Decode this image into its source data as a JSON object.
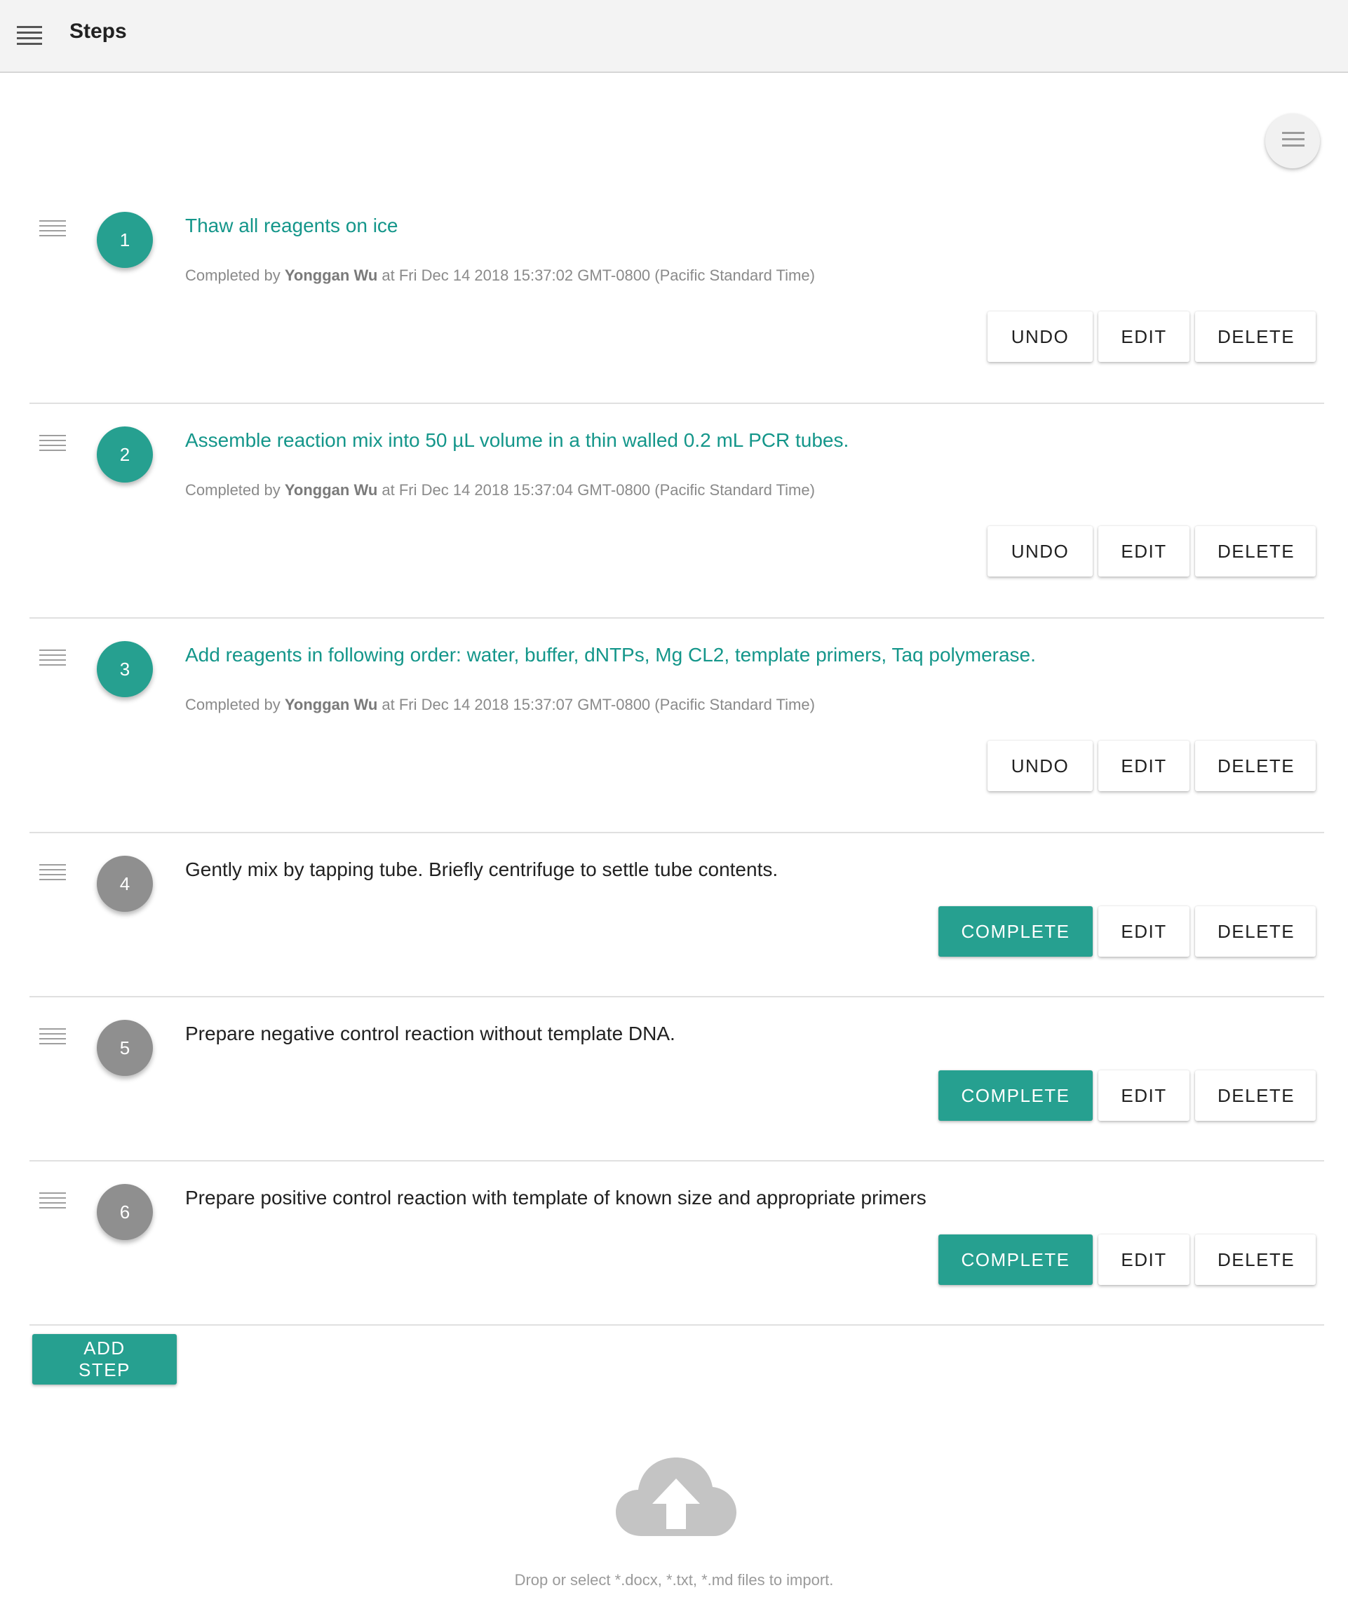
{
  "header": {
    "title": "Steps",
    "menu_icon": "hamburger-menu-icon"
  },
  "options_button": {
    "icon": "list-icon"
  },
  "colors": {
    "accent": "#26a090",
    "completed_text": "#14968a",
    "pending_circle": "#8f8f8f",
    "topbar": "#f3f3f3"
  },
  "steps": [
    {
      "number": "1",
      "status": "completed",
      "text": "Thaw all reagents on ice",
      "completed_prefix": "Completed by",
      "completed_by": "Yonggan Wu",
      "completed_at": "at Fri Dec 14 2018 15:37:02 GMT-0800 (Pacific Standard Time)",
      "primary_label": "UNDO",
      "edit_label": "EDIT",
      "delete_label": "DELETE"
    },
    {
      "number": "2",
      "status": "completed",
      "text": "Assemble reaction mix into 50 µL volume in a thin walled 0.2 mL PCR tubes.",
      "completed_prefix": "Completed by",
      "completed_by": "Yonggan Wu",
      "completed_at": "at Fri Dec 14 2018 15:37:04 GMT-0800 (Pacific Standard Time)",
      "primary_label": "UNDO",
      "edit_label": "EDIT",
      "delete_label": "DELETE"
    },
    {
      "number": "3",
      "status": "completed",
      "text": "Add reagents in following order: water, buffer, dNTPs, Mg CL2, template primers, Taq polymerase.",
      "completed_prefix": "Completed by",
      "completed_by": "Yonggan Wu",
      "completed_at": "at Fri Dec 14 2018 15:37:07 GMT-0800 (Pacific Standard Time)",
      "primary_label": "UNDO",
      "edit_label": "EDIT",
      "delete_label": "DELETE"
    },
    {
      "number": "4",
      "status": "pending",
      "text": "Gently mix by tapping tube. Briefly centrifuge to settle tube contents.",
      "primary_label": "COMPLETE",
      "edit_label": "EDIT",
      "delete_label": "DELETE"
    },
    {
      "number": "5",
      "status": "pending",
      "text": "Prepare negative control reaction without template DNA.",
      "primary_label": "COMPLETE",
      "edit_label": "EDIT",
      "delete_label": "DELETE"
    },
    {
      "number": "6",
      "status": "pending",
      "text": "Prepare positive control reaction with template of known size and appropriate primers",
      "primary_label": "COMPLETE",
      "edit_label": "EDIT",
      "delete_label": "DELETE"
    }
  ],
  "add_step_label": "ADD STEP",
  "import": {
    "icon": "cloud-upload-icon",
    "hint": "Drop or select *.docx, *.txt, *.md files to import."
  }
}
